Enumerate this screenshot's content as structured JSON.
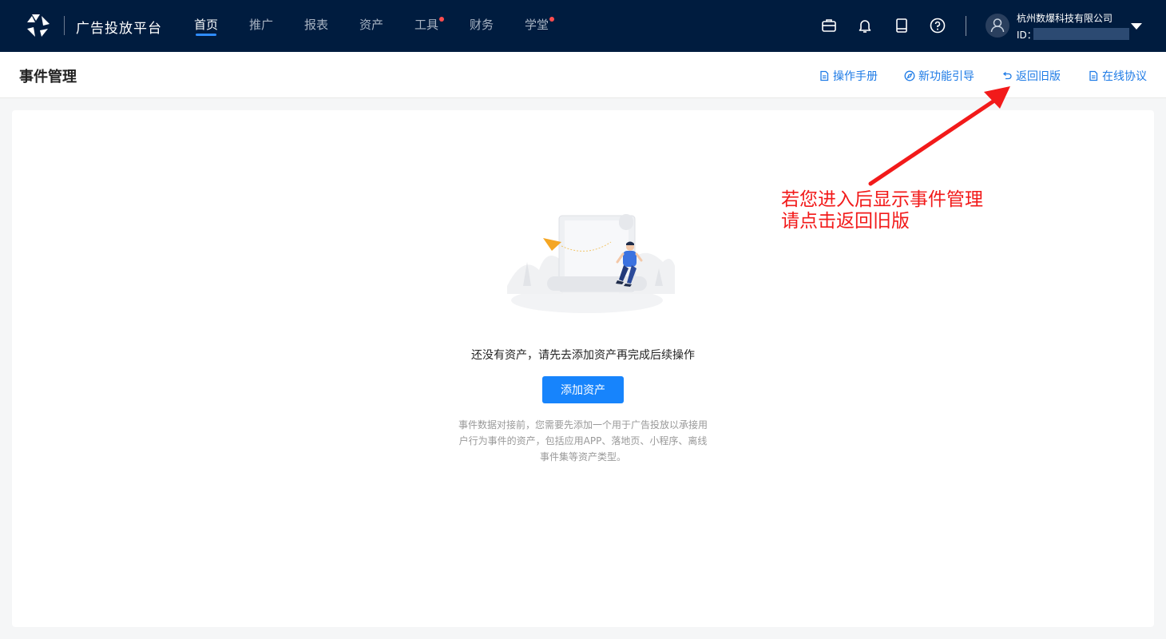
{
  "brand": {
    "name": "广告投放平台"
  },
  "nav": {
    "items": [
      {
        "label": "首页"
      },
      {
        "label": "推广"
      },
      {
        "label": "报表"
      },
      {
        "label": "资产"
      },
      {
        "label": "工具"
      },
      {
        "label": "财务"
      },
      {
        "label": "学堂"
      }
    ]
  },
  "account": {
    "company": "杭州数爆科技有限公司",
    "id_label": "ID："
  },
  "page": {
    "title": "事件管理"
  },
  "header_links": {
    "manual": "操作手册",
    "guide": "新功能引导",
    "old_version": "返回旧版",
    "agreement": "在线协议"
  },
  "empty_state": {
    "message": "还没有资产，请先去添加资产再完成后续操作",
    "button": "添加资产",
    "hint": "事件数据对接前，您需要先添加一个用于广告投放以承接用户行为事件的资产，包括应用APP、落地页、小程序、离线事件集等资产类型。"
  },
  "annotation": {
    "line1": "若您进入后显示事件管理",
    "line2": "请点击返回旧版"
  },
  "colors": {
    "topbar": "#001c3f",
    "accent": "#1784fc",
    "link": "#1e7be6",
    "badge": "#ff4d4f",
    "annotation": "#f21a1a"
  },
  "icons": [
    "logo-icon",
    "briefcase-icon",
    "bell-icon",
    "tablet-icon",
    "help-icon",
    "user-icon",
    "chevron-down-icon",
    "document-icon",
    "compass-icon",
    "undo-icon"
  ]
}
